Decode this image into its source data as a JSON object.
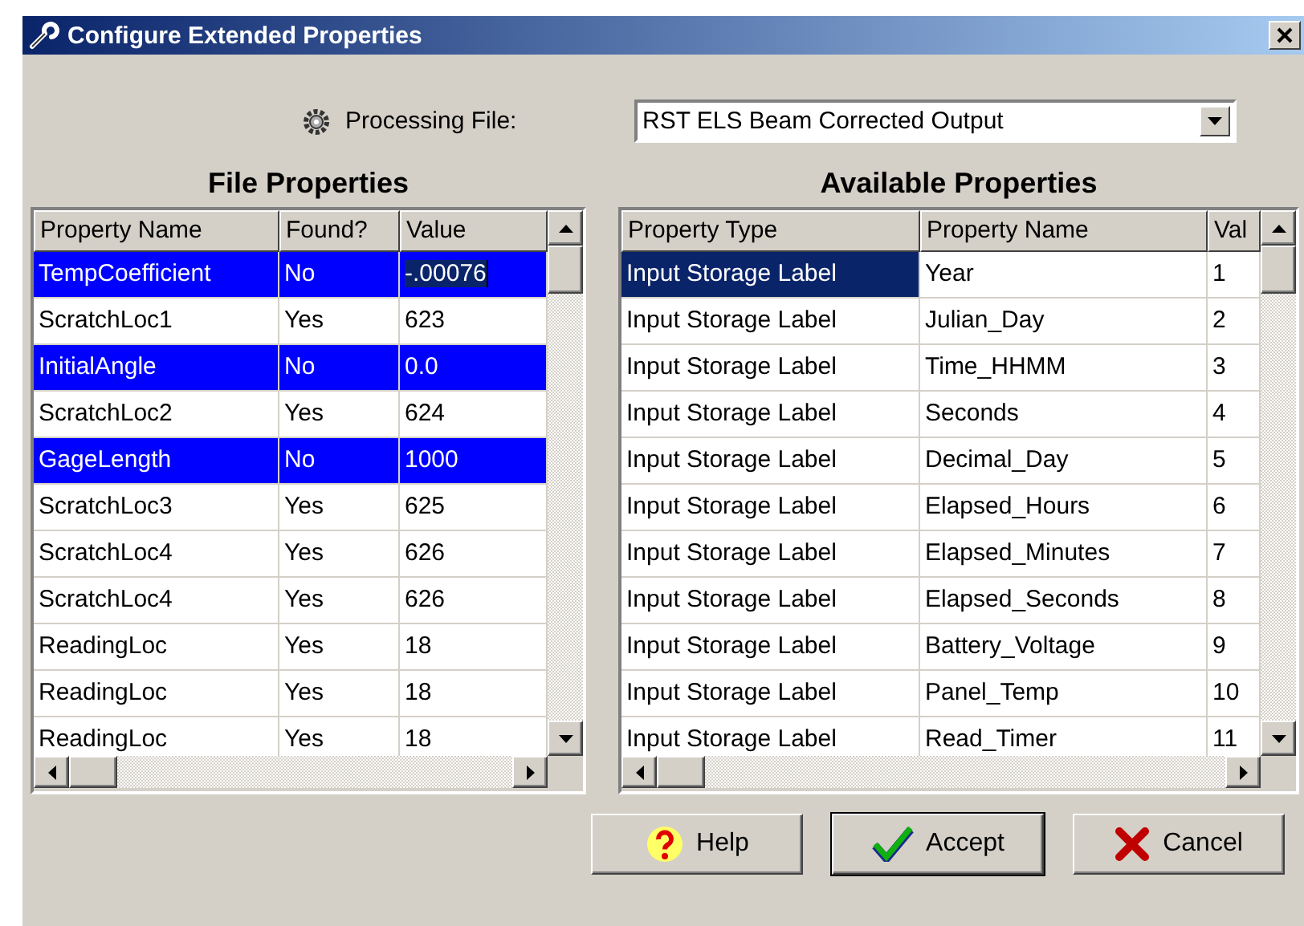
{
  "window": {
    "title": "Configure Extended Properties"
  },
  "processing_file": {
    "label": "Processing File:",
    "value": "RST ELS Beam Corrected Output"
  },
  "file_properties": {
    "title": "File Properties",
    "columns": [
      "Property Name",
      "Found?",
      "Value"
    ],
    "rows": [
      {
        "cells": [
          "TempCoefficient",
          "No",
          "-.00076"
        ],
        "selected": true,
        "editing": true
      },
      {
        "cells": [
          "ScratchLoc1",
          "Yes",
          "623"
        ],
        "selected": false,
        "editing": false
      },
      {
        "cells": [
          "InitialAngle",
          "No",
          "0.0"
        ],
        "selected": true,
        "editing": false
      },
      {
        "cells": [
          "ScratchLoc2",
          "Yes",
          "624"
        ],
        "selected": false,
        "editing": false
      },
      {
        "cells": [
          "GageLength",
          "No",
          "1000"
        ],
        "selected": true,
        "editing": false
      },
      {
        "cells": [
          "ScratchLoc3",
          "Yes",
          "625"
        ],
        "selected": false,
        "editing": false
      },
      {
        "cells": [
          "ScratchLoc4",
          "Yes",
          "626"
        ],
        "selected": false,
        "editing": false
      },
      {
        "cells": [
          "ScratchLoc4",
          "Yes",
          "626"
        ],
        "selected": false,
        "editing": false
      },
      {
        "cells": [
          "ReadingLoc",
          "Yes",
          "18"
        ],
        "selected": false,
        "editing": false
      },
      {
        "cells": [
          "ReadingLoc",
          "Yes",
          "18"
        ],
        "selected": false,
        "editing": false
      },
      {
        "cells": [
          "ReadingLoc",
          "Yes",
          "18"
        ],
        "selected": false,
        "editing": false
      }
    ]
  },
  "available_properties": {
    "title": "Available Properties",
    "columns": [
      "Property Type",
      "Property Name",
      "Val"
    ],
    "rows": [
      {
        "cells": [
          "Input Storage Label",
          "Year",
          "1"
        ],
        "selected": true
      },
      {
        "cells": [
          "Input Storage Label",
          "Julian_Day",
          "2"
        ],
        "selected": false
      },
      {
        "cells": [
          "Input Storage Label",
          "Time_HHMM",
          "3"
        ],
        "selected": false
      },
      {
        "cells": [
          "Input Storage Label",
          "Seconds",
          "4"
        ],
        "selected": false
      },
      {
        "cells": [
          "Input Storage Label",
          "Decimal_Day",
          "5"
        ],
        "selected": false
      },
      {
        "cells": [
          "Input Storage Label",
          "Elapsed_Hours",
          "6"
        ],
        "selected": false
      },
      {
        "cells": [
          "Input Storage Label",
          "Elapsed_Minutes",
          "7"
        ],
        "selected": false
      },
      {
        "cells": [
          "Input Storage Label",
          "Elapsed_Seconds",
          "8"
        ],
        "selected": false
      },
      {
        "cells": [
          "Input Storage Label",
          "Battery_Voltage",
          "9"
        ],
        "selected": false
      },
      {
        "cells": [
          "Input Storage Label",
          "Panel_Temp",
          "10"
        ],
        "selected": false
      },
      {
        "cells": [
          "Input Storage Label",
          "Read_Timer",
          "11"
        ],
        "selected": false
      }
    ]
  },
  "buttons": [
    {
      "kind": "help",
      "label": "Help",
      "default": false
    },
    {
      "kind": "accept",
      "label": "Accept",
      "default": true
    },
    {
      "kind": "cancel",
      "label": "Cancel",
      "default": false
    }
  ]
}
